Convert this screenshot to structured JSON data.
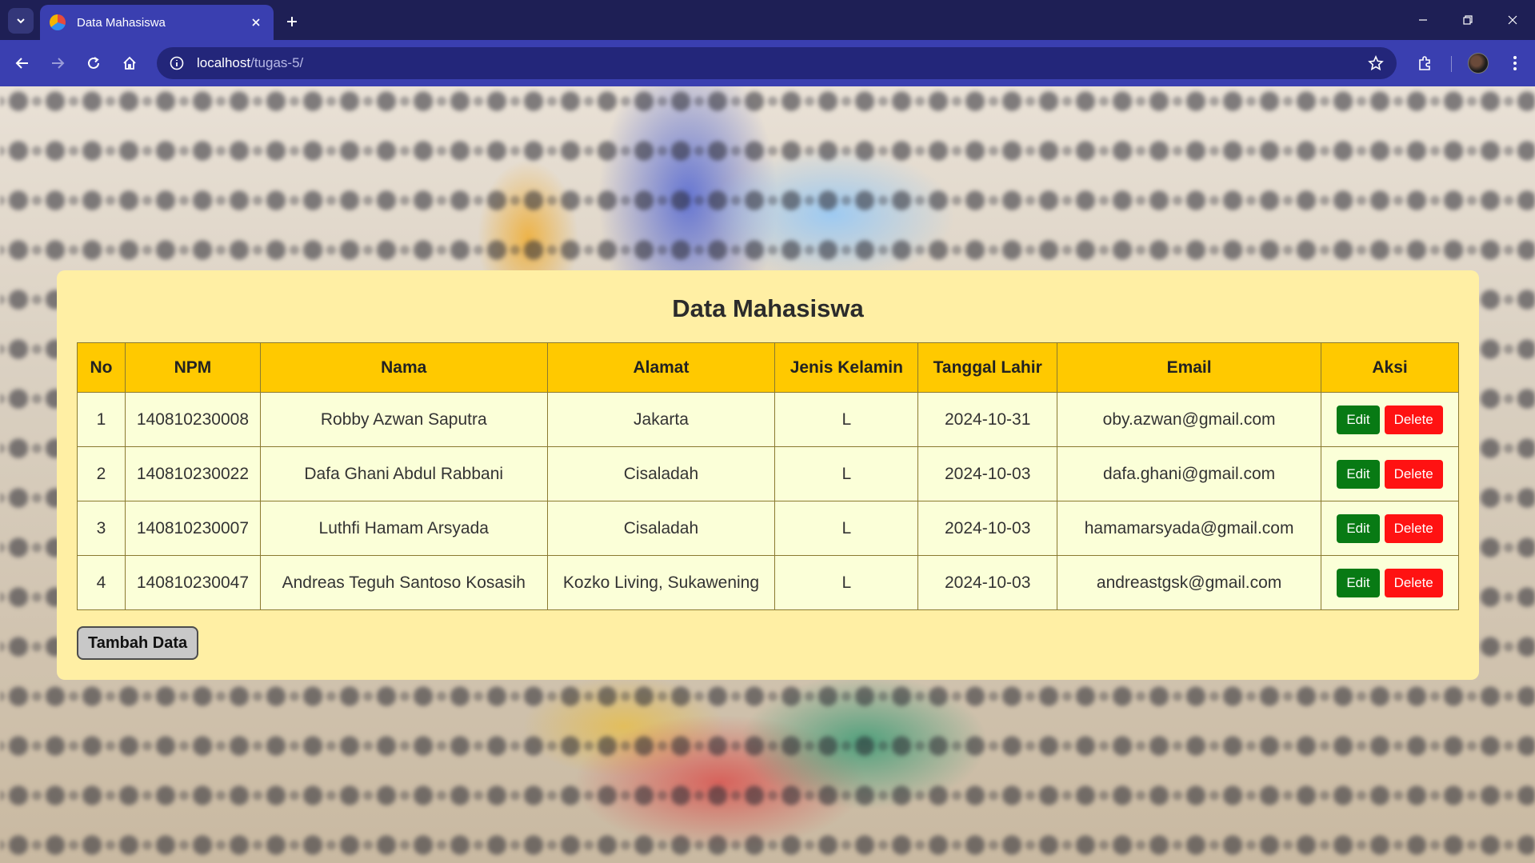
{
  "browser": {
    "tab_title": "Data Mahasiswa",
    "url_host": "localhost",
    "url_path": "/tugas-5/"
  },
  "page": {
    "title": "Data Mahasiswa",
    "add_button": "Tambah Data"
  },
  "table": {
    "headers": [
      "No",
      "NPM",
      "Nama",
      "Alamat",
      "Jenis Kelamin",
      "Tanggal Lahir",
      "Email",
      "Aksi"
    ],
    "rows": [
      {
        "no": "1",
        "npm": "140810230008",
        "nama": "Robby Azwan Saputra",
        "alamat": "Jakarta",
        "jk": "L",
        "tgl": "2024-10-31",
        "email": "oby.azwan@gmail.com"
      },
      {
        "no": "2",
        "npm": "140810230022",
        "nama": "Dafa Ghani Abdul Rabbani",
        "alamat": "Cisaladah",
        "jk": "L",
        "tgl": "2024-10-03",
        "email": "dafa.ghani@gmail.com"
      },
      {
        "no": "3",
        "npm": "140810230007",
        "nama": "Luthfi Hamam Arsyada",
        "alamat": "Cisaladah",
        "jk": "L",
        "tgl": "2024-10-03",
        "email": "hamamarsyada@gmail.com"
      },
      {
        "no": "4",
        "npm": "140810230047",
        "nama": "Andreas Teguh Santoso Kosasih",
        "alamat": "Kozko Living, Sukawening",
        "jk": "L",
        "tgl": "2024-10-03",
        "email": "andreastgsk@gmail.com"
      }
    ],
    "edit_label": "Edit",
    "delete_label": "Delete"
  },
  "colors": {
    "card_bg": "#ffefa4",
    "header_bg": "#ffc900",
    "row_bg": "#fbffd8",
    "edit_btn": "#087a14",
    "delete_btn": "#ff1212",
    "chrome_tabbar": "#1e1f55",
    "chrome_toolbar": "#3a3fb0"
  },
  "icons": [
    "tab-search-icon",
    "favicon-icon",
    "close-icon",
    "plus-icon",
    "minimize-icon",
    "restore-icon",
    "window-close-icon",
    "back-icon",
    "forward-icon",
    "reload-icon",
    "home-icon",
    "site-info-icon",
    "star-icon",
    "extensions-icon",
    "menu-icon"
  ]
}
